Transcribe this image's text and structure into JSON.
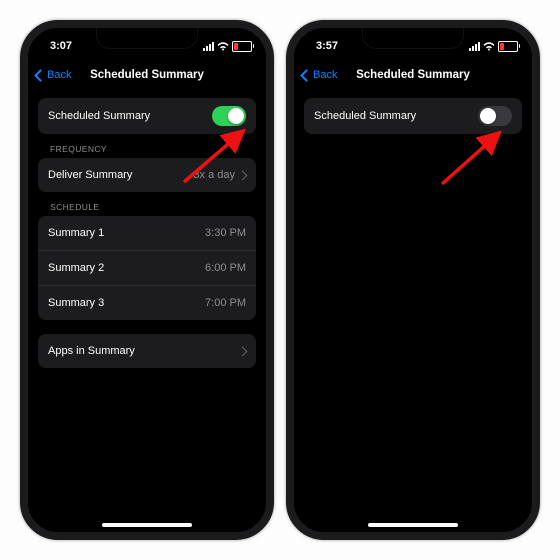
{
  "left": {
    "status_time": "3:07",
    "battery_color": "#ff3b30",
    "back_label": "Back",
    "nav_title": "Scheduled Summary",
    "main_toggle_label": "Scheduled Summary",
    "main_toggle_on": true,
    "frequency_header": "FREQUENCY",
    "deliver_label": "Deliver Summary",
    "deliver_value": "3x a day",
    "schedule_header": "SCHEDULE",
    "summary1_label": "Summary 1",
    "summary1_value": "3:30 PM",
    "summary2_label": "Summary 2",
    "summary2_value": "6:00 PM",
    "summary3_label": "Summary 3",
    "summary3_value": "7:00 PM",
    "apps_label": "Apps in Summary"
  },
  "right": {
    "status_time": "3:57",
    "battery_color": "#ff3b30",
    "back_label": "Back",
    "nav_title": "Scheduled Summary",
    "main_toggle_label": "Scheduled Summary",
    "main_toggle_on": false
  },
  "arrow_color": "#e11"
}
